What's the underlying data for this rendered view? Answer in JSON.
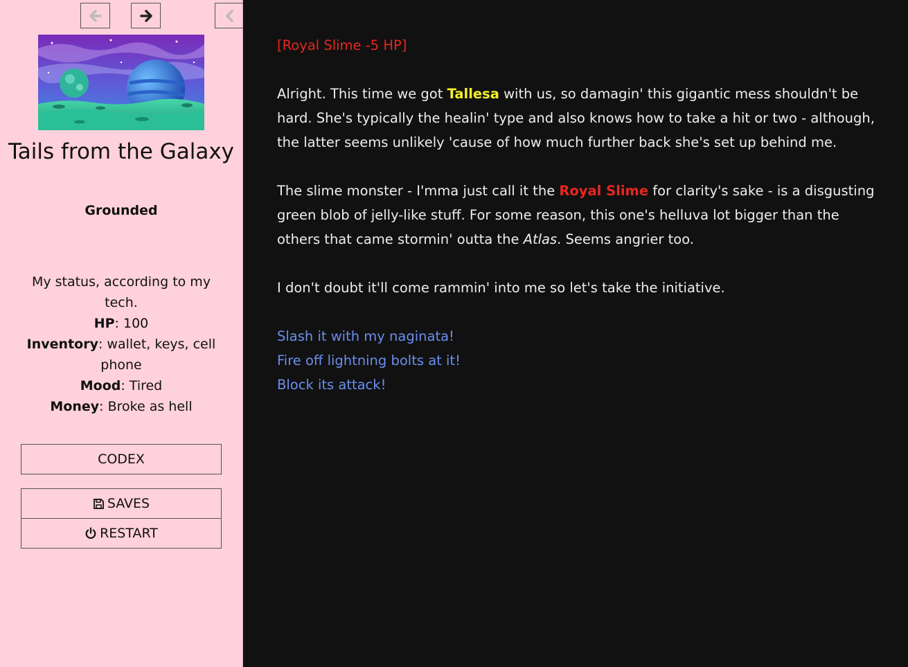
{
  "colors": {
    "sidebar_bg": "#ffd1dc",
    "main_bg": "#111111",
    "damage_text": "#e8271f",
    "ally_highlight": "#f4f02b",
    "enemy_highlight": "#e8271f",
    "link": "#6b8ff0"
  },
  "icons": {
    "back": "arrow-left-icon",
    "forward": "arrow-right-icon",
    "toggle": "chevron-left-icon",
    "saves": "floppy-disk-icon",
    "restart": "power-icon"
  },
  "sidebar": {
    "title": "Tails from the Galaxy",
    "subtitle": "Grounded",
    "status_intro": "My status, according to my tech.",
    "stats": [
      {
        "label": "HP",
        "value": ": 100"
      },
      {
        "label": "Inventory",
        "value": ": wallet, keys, cell phone"
      },
      {
        "label": "Mood",
        "value": ": Tired"
      },
      {
        "label": "Money",
        "value": ": Broke as hell"
      }
    ],
    "buttons": {
      "codex": "CODEX",
      "saves": "SAVES",
      "restart": "RESTART"
    }
  },
  "passage": {
    "damage_notice": "[Royal Slime -5 HP]",
    "p1": {
      "before": "Alright. This time we got ",
      "ally": "Tallesa",
      "after": " with us, so damagin' this gigantic mess shouldn't be hard. She's typically the healin' type and also knows how to take a hit or two - although, the latter seems unlikely 'cause of how much further back she's set up behind me."
    },
    "p2": {
      "before": "The slime monster - I'mma just call it the ",
      "enemy": "Royal Slime",
      "middle": " for clarity's sake - is a disgusting green blob of jelly-like stuff. For some reason, this one's helluva lot bigger than the others that came stormin' outta the ",
      "ship": "Atlas",
      "after": ". Seems angrier too."
    },
    "p3": "I don't doubt it'll come rammin' into me so let's take the initiative.",
    "choices": [
      "Slash it with my naginata!",
      "Fire off lightning bolts at it!",
      "Block its attack!"
    ]
  }
}
